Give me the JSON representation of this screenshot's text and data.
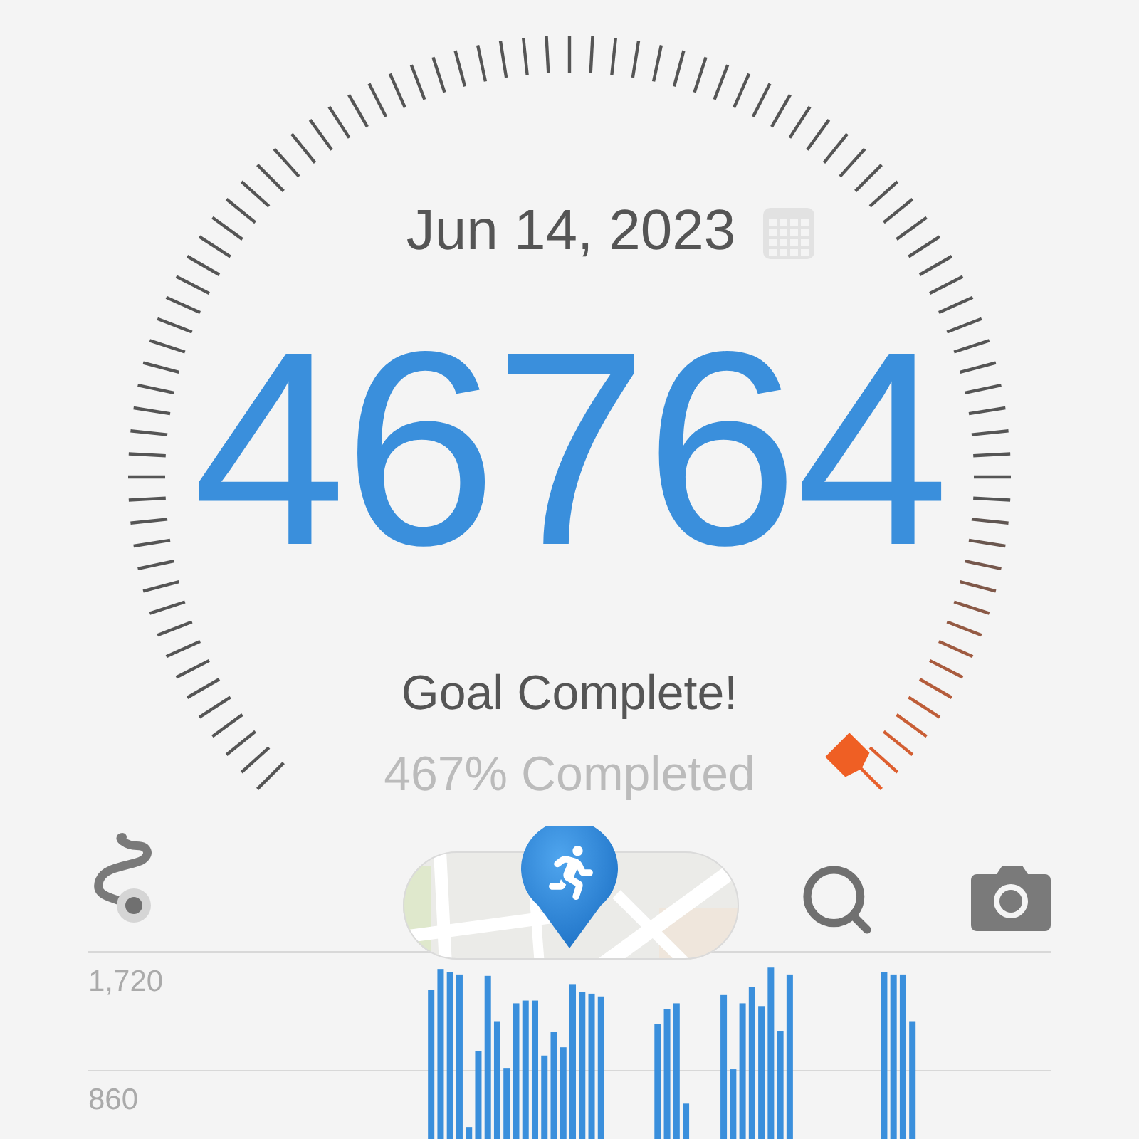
{
  "date": "Jun 14, 2023",
  "steps": "46764",
  "goal_status": "Goal Complete!",
  "percent": "467% Completed",
  "chart": {
    "gridline_labels": [
      "1,720",
      "860"
    ]
  }
}
